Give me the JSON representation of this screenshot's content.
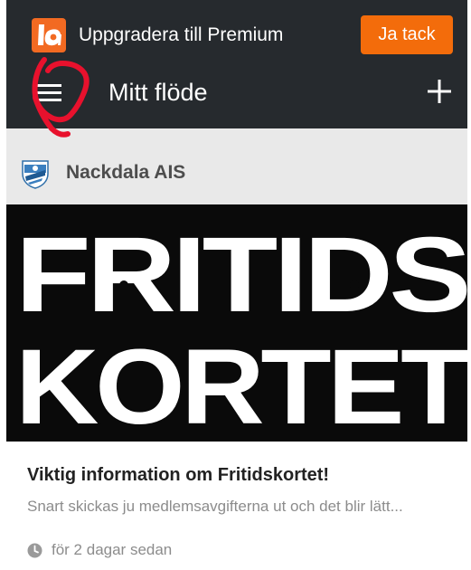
{
  "promo": {
    "text": "Uppgradera till Premium",
    "button_label": "Ja tack",
    "logo_letters": "la"
  },
  "header": {
    "title": "Mitt flöde",
    "menu_icon": "hamburger-menu-icon",
    "add_icon": "plus-icon"
  },
  "club": {
    "name": "Nackdala AIS"
  },
  "post": {
    "image_text_line1": "FRITIDS",
    "image_text_line2": "KORTET",
    "title": "Viktig information om Fritidskortet!",
    "excerpt": "Snart skickas ju medlemsavgifterna ut och det blir lätt...",
    "time": "för 2 dagar sedan",
    "time_icon": "clock-icon"
  },
  "colors": {
    "header_bg": "#262a2e",
    "accent": "#f36c0b",
    "club_row_bg": "#e9e9e9",
    "annotation": "#e8112d"
  }
}
